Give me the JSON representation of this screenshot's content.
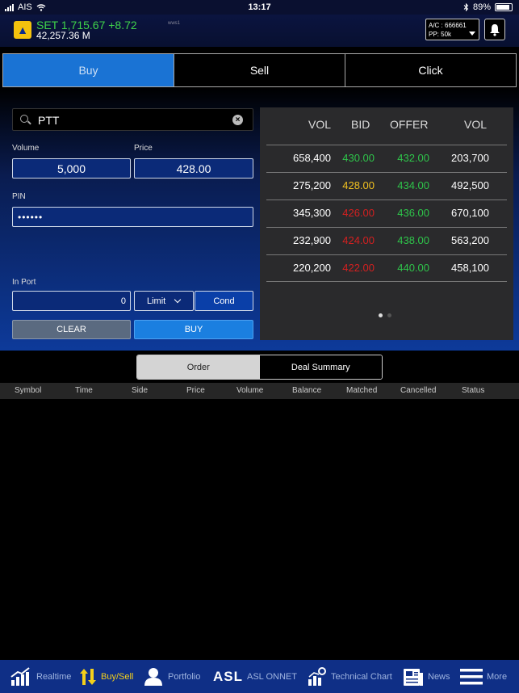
{
  "status_bar": {
    "carrier": "AIS",
    "time": "13:17",
    "battery": "89%"
  },
  "header": {
    "index_line": "SET 1,715.67 +8.72",
    "value_line": "42,257.36 M",
    "tiny_text": "wws1",
    "account_line": "A/C : 666661",
    "pp_line": "PP: 50k"
  },
  "tabs": [
    {
      "label": "Buy"
    },
    {
      "label": "Sell"
    },
    {
      "label": "Click"
    }
  ],
  "form": {
    "symbol": "PTT",
    "volume_label": "Volume",
    "volume_value": "5,000",
    "price_label": "Price",
    "price_value": "428.00",
    "pin_label": "PIN",
    "pin_value": "••••••",
    "in_port_label": "In Port",
    "in_port_value": "0",
    "order_type": "Limit",
    "cond_label": "Cond",
    "clear_label": "CLEAR",
    "buy_label": "BUY"
  },
  "book": {
    "headers": {
      "vol_bid": "VOL",
      "bid": "BID",
      "offer": "OFFER",
      "vol_offer": "VOL"
    },
    "rows": [
      {
        "bid_vol": "658,400",
        "bid": "430.00",
        "offer": "432.00",
        "offer_vol": "203,700"
      },
      {
        "bid_vol": "275,200",
        "bid": "428.00",
        "offer": "434.00",
        "offer_vol": "492,500"
      },
      {
        "bid_vol": "345,300",
        "bid": "426.00",
        "offer": "436.00",
        "offer_vol": "670,100"
      },
      {
        "bid_vol": "232,900",
        "bid": "424.00",
        "offer": "438.00",
        "offer_vol": "563,200"
      },
      {
        "bid_vol": "220,200",
        "bid": "422.00",
        "offer": "440.00",
        "offer_vol": "458,100"
      }
    ],
    "colors": {
      "up": "#2ec44a",
      "unchanged": "#f0c020",
      "down": "#d42020"
    }
  },
  "segment": {
    "order": "Order",
    "deal_summary": "Deal Summary"
  },
  "columns": [
    "Symbol",
    "Time",
    "Side",
    "Price",
    "Volume",
    "Balance",
    "Matched",
    "Cancelled",
    "Status"
  ],
  "nav": [
    {
      "label": "Realtime",
      "icon": "chart-up-icon"
    },
    {
      "label": "Buy/Sell",
      "icon": "arrows-updown-icon"
    },
    {
      "label": "Portfolio",
      "icon": "person-icon"
    },
    {
      "label": "ASL ONNET",
      "icon": "asl-logo",
      "logo_text": "ASL"
    },
    {
      "label": "Technical Chart",
      "icon": "tech-chart-icon"
    },
    {
      "label": "News",
      "icon": "news-icon"
    },
    {
      "label": "More",
      "icon": "menu-icon"
    }
  ]
}
